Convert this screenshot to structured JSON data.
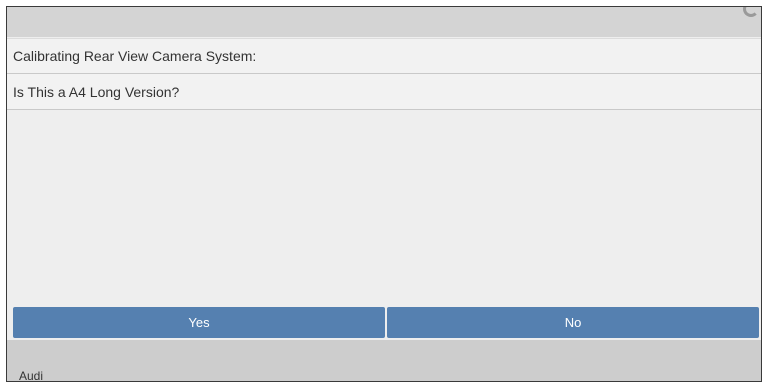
{
  "header": {
    "corner_icon": "refresh-icon"
  },
  "dialog": {
    "title": "Calibrating Rear View Camera System:",
    "question": "Is This a A4 Long Version?"
  },
  "buttons": {
    "yes_label": "Yes",
    "no_label": "No"
  },
  "footer": {
    "brand": "Audi"
  },
  "colors": {
    "button": "#5580b0",
    "background": "#eeeeee",
    "bar": "#d4d4d4"
  }
}
